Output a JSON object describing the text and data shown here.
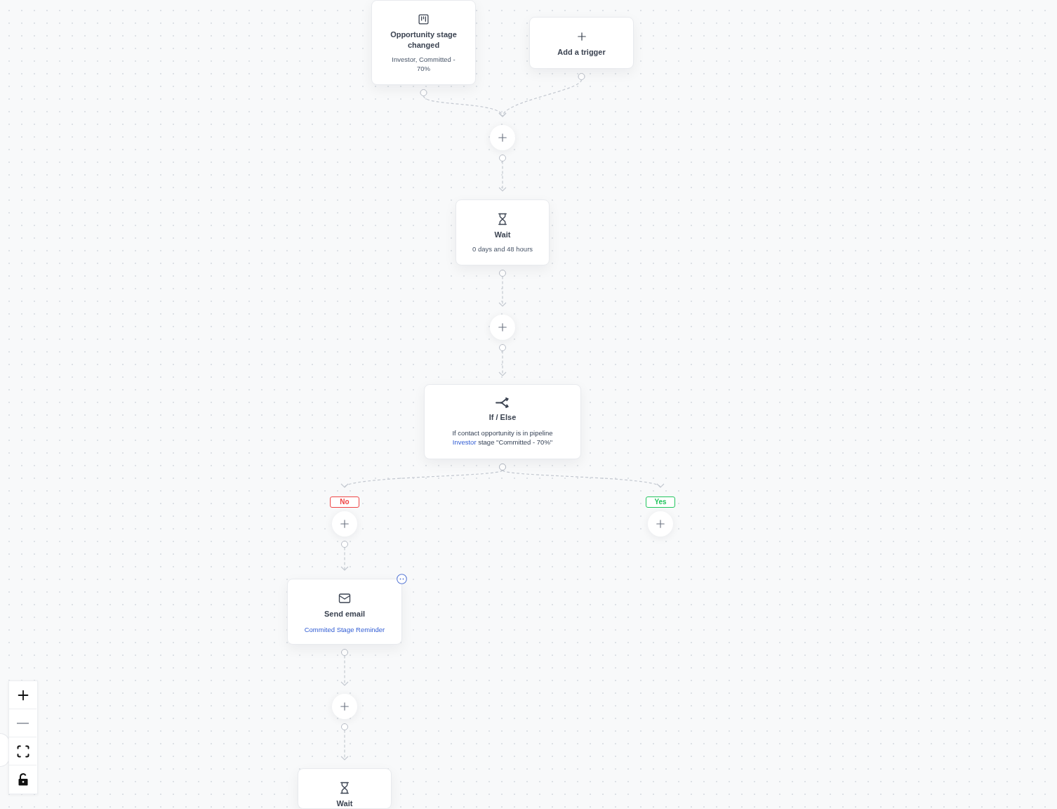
{
  "canvas": {
    "triggers": [
      {
        "kind": "stage",
        "title": "Opportunity stage changed",
        "subtitle": {
          "kind": "plain",
          "text": "Investor, Committed - 70%"
        }
      },
      {
        "kind": "add",
        "title": "Add a trigger"
      }
    ],
    "actions": [
      {
        "kind": "wait",
        "title": "Wait",
        "subtitle": {
          "kind": "plain",
          "text": "0 days and 48 hours"
        }
      },
      {
        "kind": "if_else",
        "title": "If / Else",
        "description": [
          {
            "kind": "plain",
            "text": "If contact opportunity is in pipeline "
          },
          {
            "kind": "link",
            "text": "Investor"
          },
          {
            "kind": "plain",
            "text": " stage \"Committed - 70%\""
          }
        ]
      }
    ],
    "branches": [
      {
        "label": "No",
        "color": "#ef4444",
        "actions": [
          {
            "kind": "email",
            "title": "Send email",
            "subtitle": {
              "kind": "link",
              "text": "Commited Stage Reminder"
            },
            "hovered": true
          },
          {
            "kind": "wait",
            "title": "Wait",
            "hovered": false
          }
        ]
      },
      {
        "label": "Yes",
        "color": "#22c55e"
      }
    ]
  },
  "zoom_controls": {
    "zoom_out_disabled": true,
    "locked": false
  }
}
